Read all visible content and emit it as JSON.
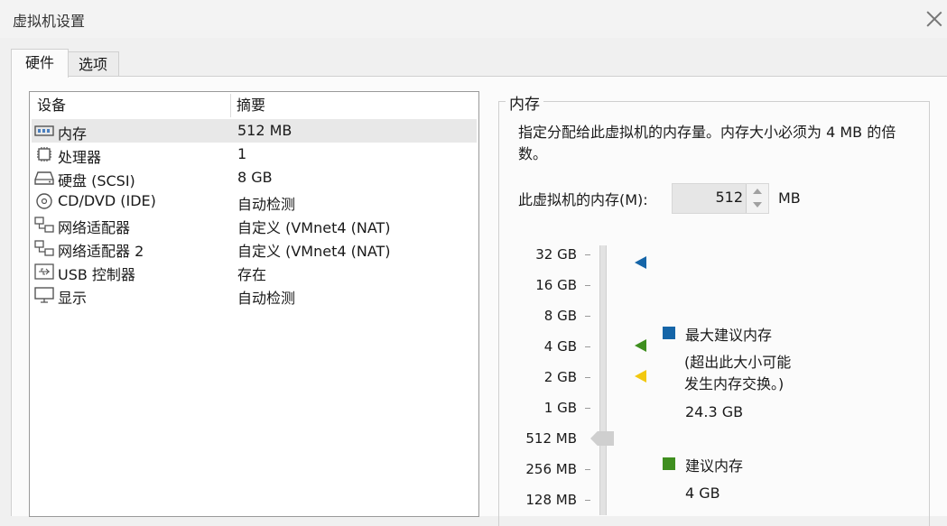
{
  "window": {
    "title": "虚拟机设置"
  },
  "tabs": [
    {
      "label": "硬件"
    },
    {
      "label": "选项"
    }
  ],
  "device_list": {
    "headers": {
      "device": "设备",
      "summary": "摘要"
    },
    "rows": [
      {
        "name": "内存",
        "summary": "512 MB",
        "icon": "memory-icon"
      },
      {
        "name": "处理器",
        "summary": "1",
        "icon": "processor-icon"
      },
      {
        "name": "硬盘 (SCSI)",
        "summary": "8 GB",
        "icon": "hard-disk-icon"
      },
      {
        "name": "CD/DVD (IDE)",
        "summary": "自动检测",
        "icon": "cd-dvd-icon"
      },
      {
        "name": "网络适配器",
        "summary": "自定义 (VMnet4 (NAT)",
        "icon": "network-adapter-icon"
      },
      {
        "name": "网络适配器 2",
        "summary": "自定义 (VMnet4 (NAT)",
        "icon": "network-adapter-icon"
      },
      {
        "name": "USB 控制器",
        "summary": "存在",
        "icon": "usb-icon"
      },
      {
        "name": "显示",
        "summary": "自动检测",
        "icon": "display-icon"
      }
    ],
    "selected": "内存"
  },
  "memory": {
    "group_title": "内存",
    "description": "指定分配给此虚拟机的内存量。内存大小必须为 4 MB 的倍数。",
    "field_label": "此虚拟机的内存(M):",
    "value": "512",
    "unit": "MB",
    "scale": [
      "32 GB",
      "16 GB",
      "8 GB",
      "4 GB",
      "2 GB",
      "1 GB",
      "512 MB",
      "256 MB",
      "128 MB"
    ],
    "current_scale_value": "512 MB",
    "markers": [
      {
        "name": "maximum",
        "color": "#1565a8",
        "scale_value": "32 GB"
      },
      {
        "name": "max-recommended",
        "color": "#3f8f1f",
        "scale_value": "4 GB"
      },
      {
        "name": "recommended",
        "color": "#f2c80f",
        "scale_value": "2 GB"
      }
    ],
    "legend": {
      "max_recommended": {
        "label": "最大建议内存",
        "color": "#1565a8",
        "note_line1": "(超出此大小可能",
        "note_line2": "发生内存交换。)",
        "value": "24.3 GB"
      },
      "recommended": {
        "label": "建议内存",
        "color": "#3f8f1f",
        "value": "4 GB"
      }
    }
  }
}
